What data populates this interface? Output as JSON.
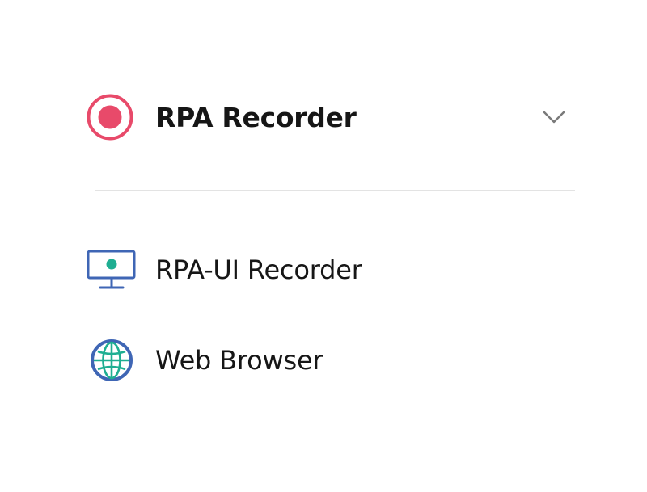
{
  "header": {
    "title": "RPA Recorder",
    "icon": "record-icon",
    "expand_icon": "chevron-down-icon"
  },
  "menu": {
    "items": [
      {
        "label": "RPA-UI Recorder",
        "icon": "monitor-icon"
      },
      {
        "label": "Web Browser",
        "icon": "globe-icon"
      }
    ]
  },
  "colors": {
    "record_accent": "#e84a6a",
    "icon_blue": "#3f66b5",
    "icon_teal": "#1fae92",
    "divider": "#e3e3e3",
    "text": "#161616",
    "chevron": "#7a7a7a"
  }
}
